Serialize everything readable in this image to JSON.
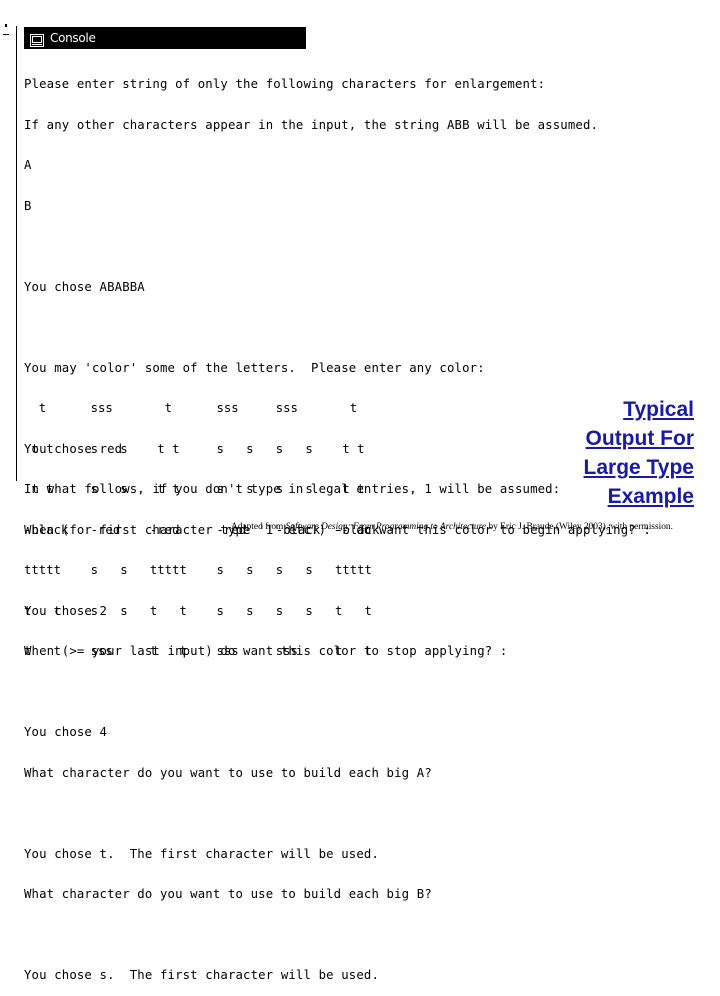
{
  "window": {
    "title": "Console",
    "icon": "console-window-icon"
  },
  "console_lines": [
    "Please enter string of only the following characters for enlargement:",
    "If any other characters appear in the input, the string ABB will be assumed.",
    "A",
    "B",
    "",
    "You chose ABABBA",
    "",
    "You may 'color' some of the letters.  Please enter any color:",
    "",
    "You chose red",
    "In what follows, if you don't type in legal entries, 1 will be assumed:",
    "When (for first character type '1' etc.) -- do want this color to begin applying? :",
    "",
    "You chose 2",
    "When (>= your last input) do want this color to stop applying? :",
    "",
    "You chose 4",
    "What character do you want to use to build each big A?",
    "",
    "You chose t.  The first character will be used.",
    "What character do you want to use to build each big B?",
    "",
    "You chose s.  The first character will be used."
  ],
  "big_letters_lines": [
    "  t      sss       t      sss     sss       t",
    " t t     s   s    t t     s   s   s   s    t t",
    " t t     s   s    t t     s   s   s   s    t t",
    "-black   -red    -red     -red    -black  -black",
    "ttttt    s   s   ttttt    s   s   s   s   ttttt",
    "t   t    s   s   t   t    s   s   s   s   t   t",
    "t   t    sss     t   t    sss     sss     t   t"
  ],
  "caption": {
    "lines": [
      "Typical",
      "Output For",
      "Large Type",
      "Example"
    ],
    "color": "#1a1aa6"
  },
  "credit": {
    "prefix": "Adapted from ",
    "book_title": "Software Design: From Programming to Architecture",
    "suffix": " by Eric J. Braude (Wiley 2003), with permission."
  }
}
